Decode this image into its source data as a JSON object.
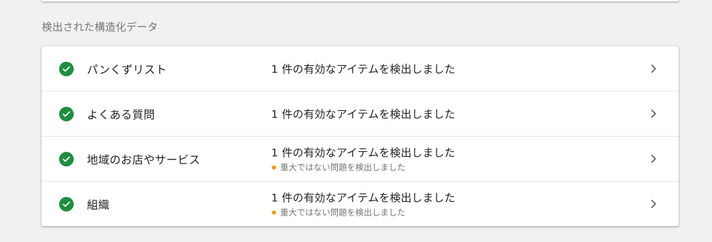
{
  "section_heading": "検出された構造化データ",
  "items": [
    {
      "name": "パンくずリスト",
      "result": "1 件の有効なアイテムを検出しました",
      "warning": ""
    },
    {
      "name": "よくある質問",
      "result": "1 件の有効なアイテムを検出しました",
      "warning": ""
    },
    {
      "name": "地域のお店やサービス",
      "result": "1 件の有効なアイテムを検出しました",
      "warning": "重大ではない問題を検出しました"
    },
    {
      "name": "組織",
      "result": "1 件の有効なアイテムを検出しました",
      "warning": "重大ではない問題を検出しました"
    }
  ],
  "colors": {
    "valid": "#1e8e3e",
    "warning": "#f29900"
  },
  "icons": {
    "status": "check-circle-icon",
    "row_action": "chevron-right-icon",
    "warning": "warning-dot-icon"
  }
}
